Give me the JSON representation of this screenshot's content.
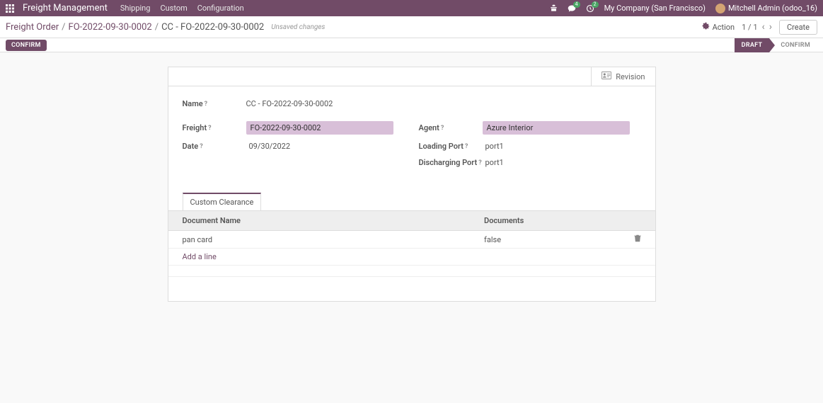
{
  "navbar": {
    "app_name": "Freight Management",
    "menu": {
      "shipping": "Shipping",
      "custom": "Custom",
      "configuration": "Configuration"
    },
    "messages_badge": "4",
    "activities_badge": "2",
    "company": "My Company (San Francisco)",
    "user": "Mitchell Admin (odoo_16)"
  },
  "breadcrumb": {
    "root": "Freight Order",
    "parent": "FO-2022-09-30-0002",
    "current": "CC - FO-2022-09-30-0002",
    "unsaved": "Unsaved changes"
  },
  "controls": {
    "action": "Action",
    "pager": "1 / 1",
    "create": "Create"
  },
  "status": {
    "confirm_btn": "CONFIRM",
    "draft": "DRAFT",
    "confirm_stage": "CONFIRM"
  },
  "sheet": {
    "revision": "Revision",
    "labels": {
      "name": "Name",
      "freight": "Freight",
      "date": "Date",
      "agent": "Agent",
      "loading_port": "Loading Port",
      "discharging_port": "Discharging Port"
    },
    "values": {
      "name": "CC - FO-2022-09-30-0002",
      "freight": "FO-2022-09-30-0002",
      "date": "09/30/2022",
      "agent": "Azure Interior",
      "loading_port": "port1",
      "discharging_port": "port1"
    },
    "tabs": {
      "custom_clearance": "Custom Clearance"
    },
    "table": {
      "col_document_name": "Document Name",
      "col_documents": "Documents",
      "rows": [
        {
          "doc_name": "pan card",
          "documents": "false"
        }
      ],
      "add_line": "Add a line"
    }
  }
}
